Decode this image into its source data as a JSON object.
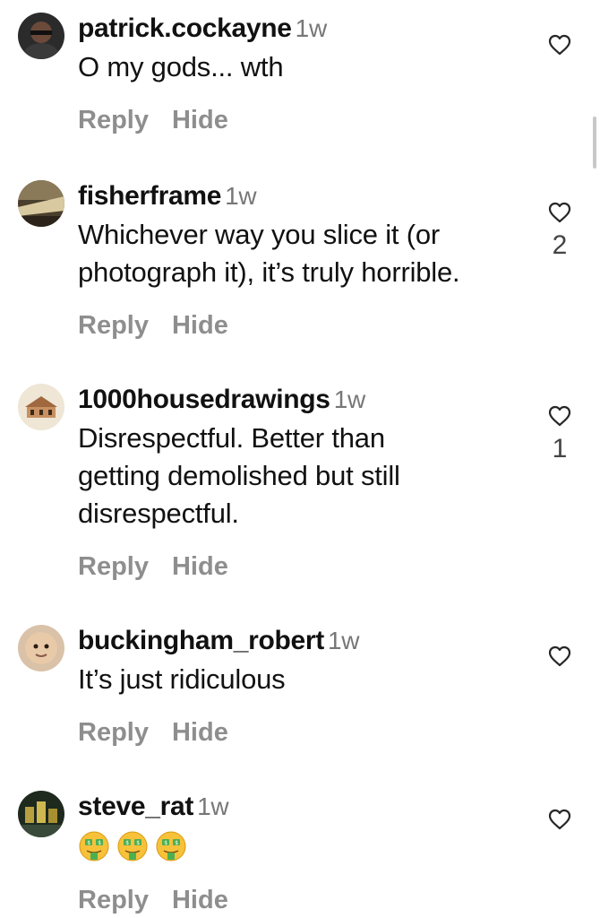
{
  "comments": [
    {
      "username": "patrick.cockayne",
      "time": "1w",
      "text": "O my gods... wth",
      "reply_label": "Reply",
      "hide_label": "Hide",
      "likes": ""
    },
    {
      "username": "fisherframe",
      "time": "1w",
      "text": "Whichever way you slice it (or photograph it), it’s truly horrible.",
      "reply_label": "Reply",
      "hide_label": "Hide",
      "likes": "2"
    },
    {
      "username": "1000housedrawings",
      "time": "1w",
      "text": "Disrespectful. Better than getting demolished but still disrespectful.",
      "reply_label": "Reply",
      "hide_label": "Hide",
      "likes": "1"
    },
    {
      "username": "buckingham_robert",
      "time": "1w",
      "text": "It’s just ridiculous",
      "reply_label": "Reply",
      "hide_label": "Hide",
      "likes": ""
    },
    {
      "username": "steve_rat",
      "time": "1w",
      "text": "",
      "emoji": "money-mouth-face x3",
      "reply_label": "Reply",
      "hide_label": "Hide",
      "likes": ""
    }
  ],
  "colors": {
    "text": "#111111",
    "secondary": "#8e8e8e",
    "timestamp": "#777777",
    "heart_stroke": "#262626"
  }
}
